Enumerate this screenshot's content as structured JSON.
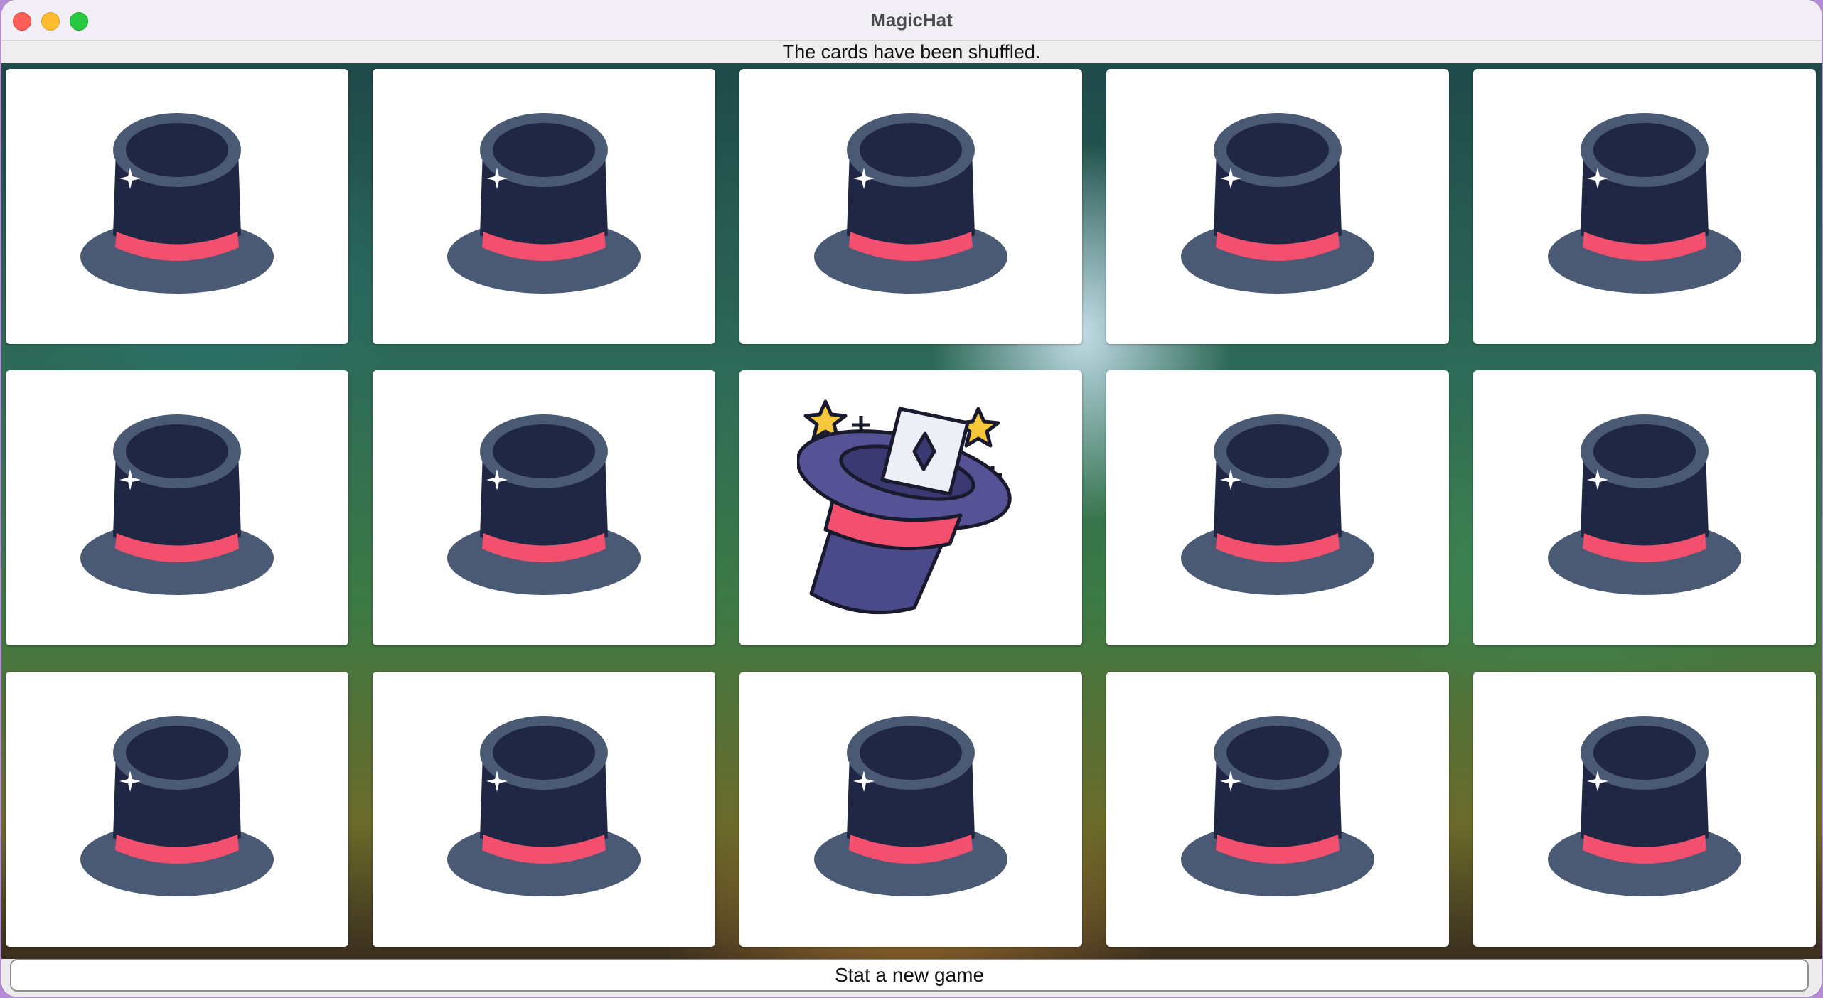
{
  "window": {
    "title": "MagicHat",
    "controls": [
      "close-icon",
      "minimize-icon",
      "zoom-icon"
    ]
  },
  "status": "The cards have been shuffled.",
  "board": {
    "rows": 3,
    "columns": 5,
    "cards": [
      {
        "row": 1,
        "col": 1,
        "face": "top-hat-icon"
      },
      {
        "row": 1,
        "col": 2,
        "face": "top-hat-icon"
      },
      {
        "row": 1,
        "col": 3,
        "face": "top-hat-icon"
      },
      {
        "row": 1,
        "col": 4,
        "face": "top-hat-icon"
      },
      {
        "row": 1,
        "col": 5,
        "face": "top-hat-icon"
      },
      {
        "row": 2,
        "col": 1,
        "face": "top-hat-icon"
      },
      {
        "row": 2,
        "col": 2,
        "face": "top-hat-icon"
      },
      {
        "row": 2,
        "col": 3,
        "face": "magic-hat-card-icon"
      },
      {
        "row": 2,
        "col": 4,
        "face": "top-hat-icon"
      },
      {
        "row": 2,
        "col": 5,
        "face": "top-hat-icon"
      },
      {
        "row": 3,
        "col": 1,
        "face": "top-hat-icon"
      },
      {
        "row": 3,
        "col": 2,
        "face": "top-hat-icon"
      },
      {
        "row": 3,
        "col": 3,
        "face": "top-hat-icon"
      },
      {
        "row": 3,
        "col": 4,
        "face": "top-hat-icon"
      },
      {
        "row": 3,
        "col": 5,
        "face": "top-hat-icon"
      }
    ]
  },
  "footer": {
    "new_game_label": "Stat a new game"
  },
  "colors": {
    "hat_dark": "#1f2744",
    "hat_brim": "#4b5a74",
    "hat_band": "#f2506e",
    "magic_hat": "#555395",
    "star": "#f6c93c"
  }
}
